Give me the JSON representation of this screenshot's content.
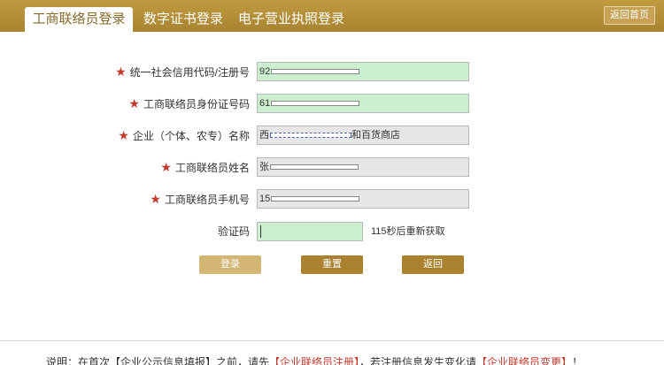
{
  "header": {
    "tabs": [
      {
        "label": "工商联络员登录",
        "active": true
      },
      {
        "label": "数字证书登录",
        "active": false
      },
      {
        "label": "电子营业执照登录",
        "active": false
      }
    ],
    "home_button": "返回首页"
  },
  "form": {
    "required_mark": "★",
    "fields": [
      {
        "label": "统一社会信用代码/注册号",
        "value": "92",
        "style": "green"
      },
      {
        "label": "工商联络员身份证号码",
        "value": "61",
        "style": "green"
      },
      {
        "label": "企业（个体、农专）名称",
        "value_prefix": "西",
        "value_suffix": "和百货商店",
        "style": "grey"
      },
      {
        "label": "工商联络员姓名",
        "value": "张",
        "style": "grey"
      },
      {
        "label": "工商联络员手机号",
        "value": "15",
        "style": "grey"
      }
    ],
    "captcha": {
      "label": "验证码",
      "value": "",
      "countdown_text": "115秒后重新获取"
    }
  },
  "buttons": {
    "login": "登录",
    "reset": "重置",
    "back": "返回"
  },
  "footer": {
    "note_prefix": "说明：在首次【企业公示信息填报】之前，请先",
    "link1": "【企业联络员注册】",
    "note_middle": "，若注册信息发生变化请",
    "link2": "【企业联络员变更】",
    "note_suffix": "！"
  },
  "colors": {
    "header": "#b08b36",
    "field_green": "#ccefcf",
    "field_grey": "#e6e6e6",
    "button": "#a9812f",
    "required": "#c0392b"
  }
}
